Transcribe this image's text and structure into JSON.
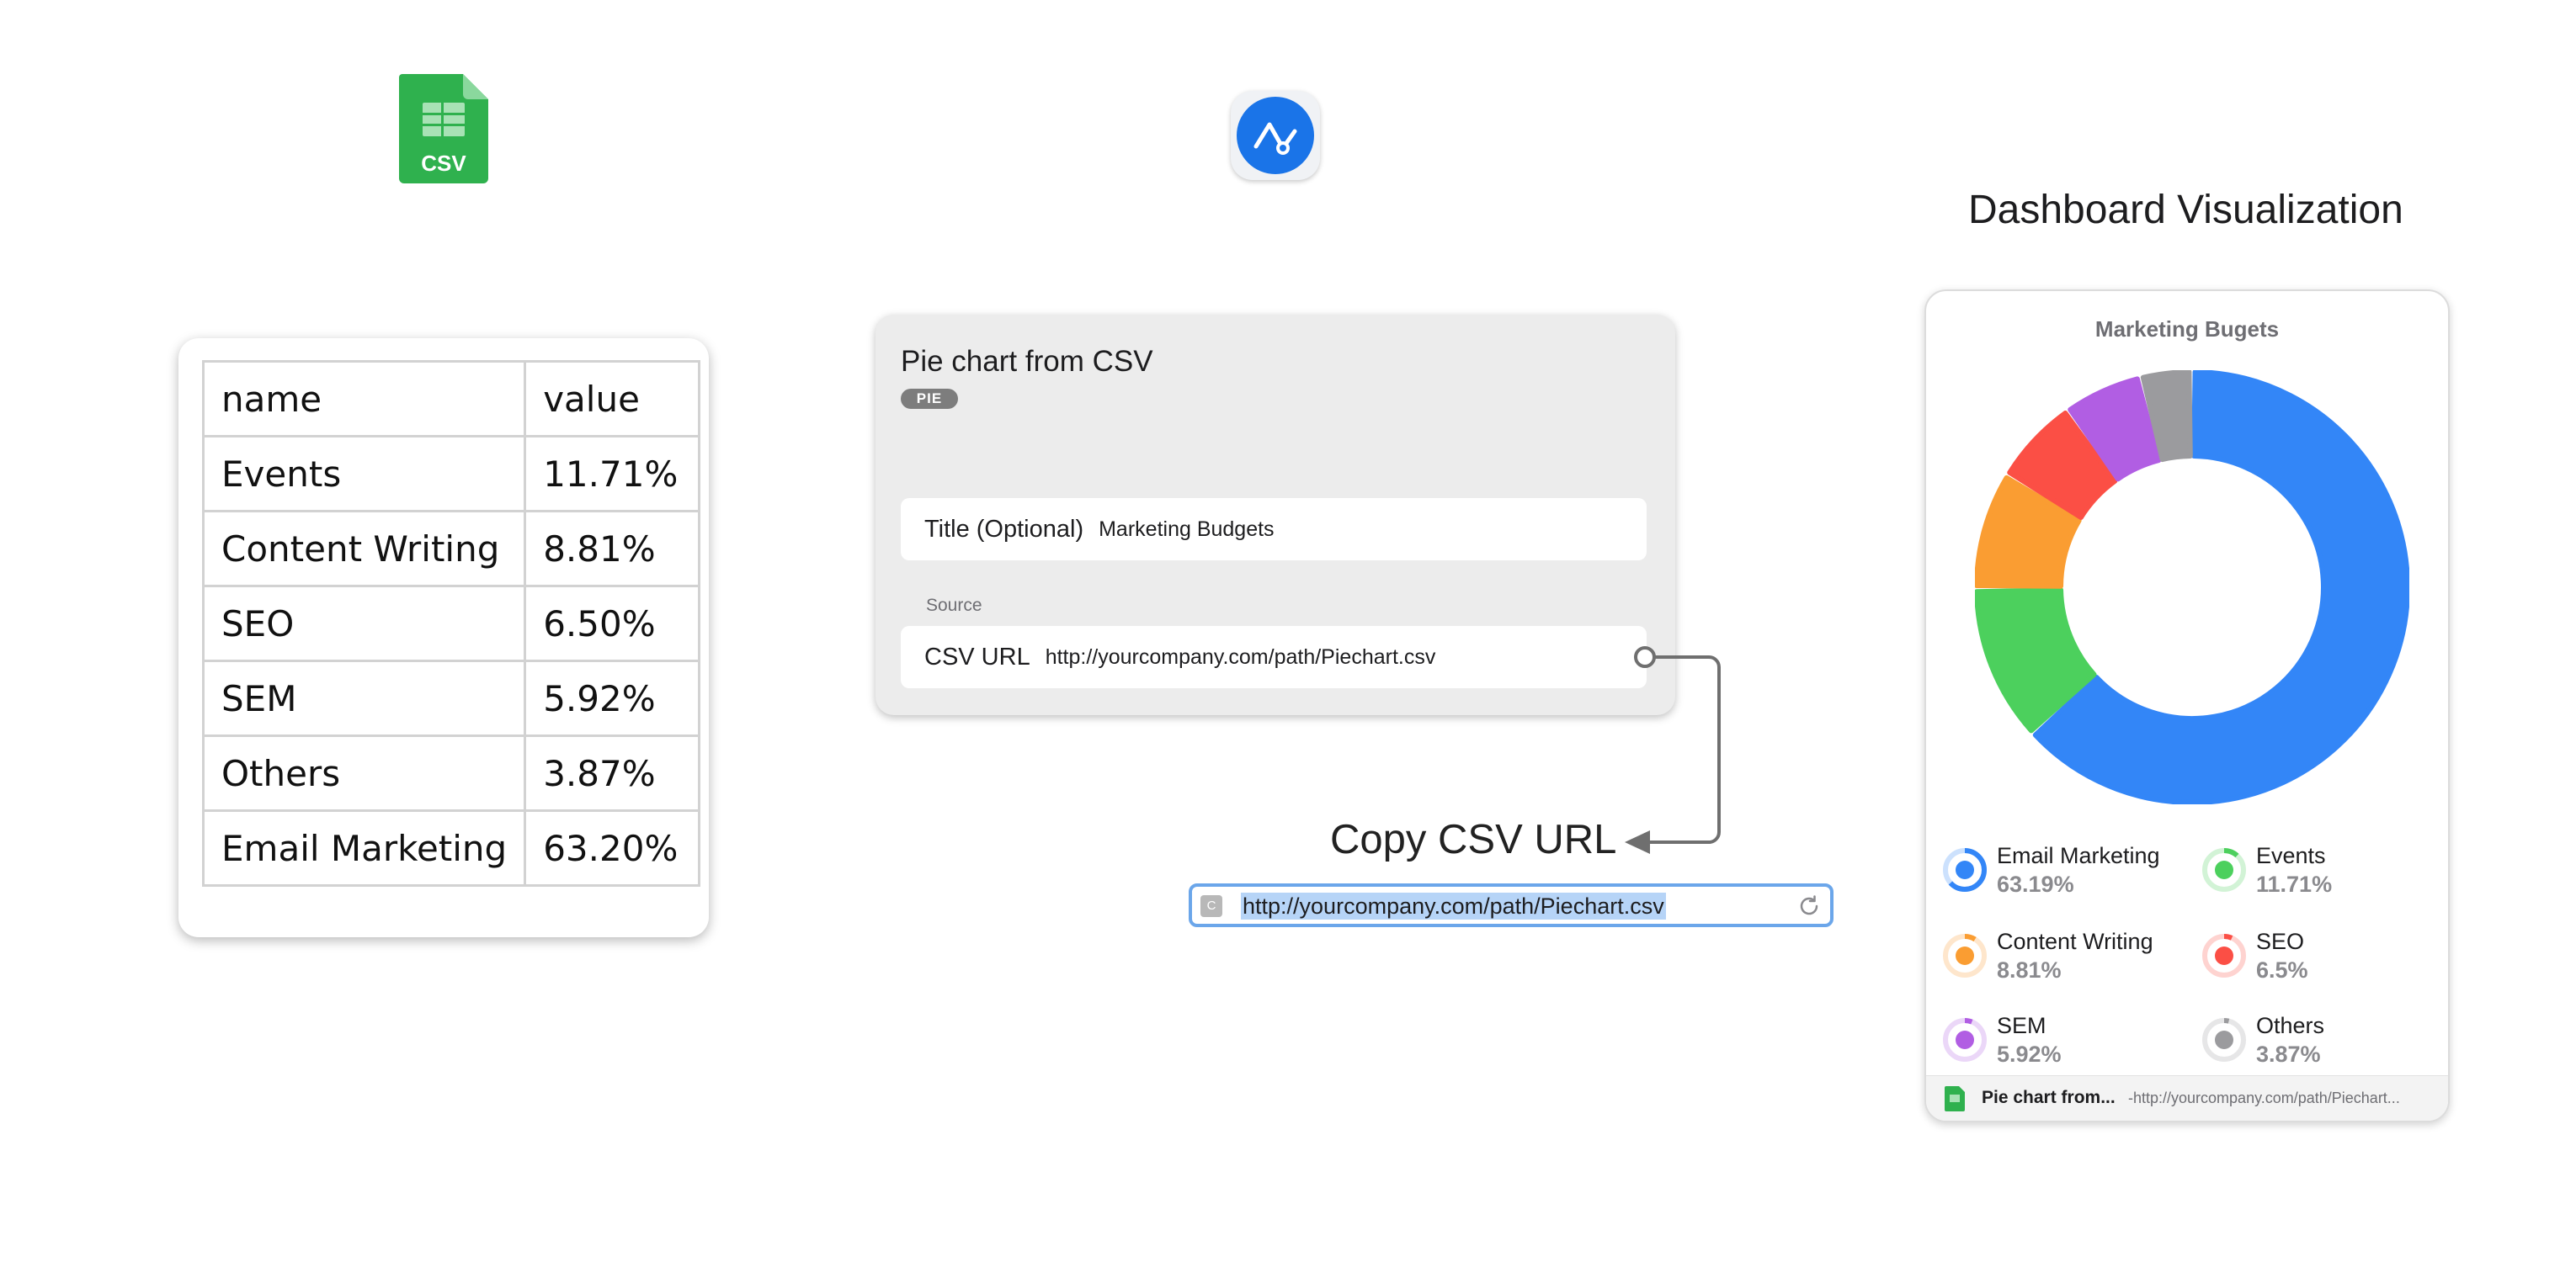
{
  "csv_icon": {
    "label": "CSV"
  },
  "csv_table": {
    "rows": [
      [
        "name",
        "value"
      ],
      [
        "Events",
        "11.71%"
      ],
      [
        "Content Writing",
        "8.81%"
      ],
      [
        "SEO",
        "6.50%"
      ],
      [
        "SEM",
        "5.92%"
      ],
      [
        "Others",
        "3.87%"
      ],
      [
        "Email Marketing",
        "63.20%"
      ]
    ]
  },
  "panel": {
    "title": "Pie chart from CSV",
    "badge": "PIE",
    "title_field": {
      "label": "Title (Optional)",
      "value": "Marketing Budgets"
    },
    "source_label": "Source",
    "csv_field": {
      "label": "CSV URL",
      "value": "http://yourcompany.com/path/Piechart.csv"
    }
  },
  "copy": {
    "label": "Copy CSV URL",
    "favicon": "C",
    "url": "http://yourcompany.com/path/Piechart.csv"
  },
  "dashboard": {
    "heading": "Dashboard Visualization",
    "footer_name": "Pie chart from...",
    "footer_url": "-http://yourcompany.com/path/Piechart..."
  },
  "chart_data": {
    "type": "pie",
    "title": "Marketing Bugets",
    "categories": [
      "Email Marketing",
      "Events",
      "Content Writing",
      "SEO",
      "SEM",
      "Others"
    ],
    "values": [
      63.19,
      11.71,
      8.81,
      6.5,
      5.92,
      3.87
    ],
    "value_labels": [
      "63.19%",
      "11.71%",
      "8.81%",
      "6.5%",
      "5.92%",
      "3.87%"
    ],
    "colors": [
      "#3386f7",
      "#4cd05d",
      "#fa9d32",
      "#fb4f45",
      "#b15ee3",
      "#9b9b9e"
    ],
    "legend": "bottom"
  }
}
